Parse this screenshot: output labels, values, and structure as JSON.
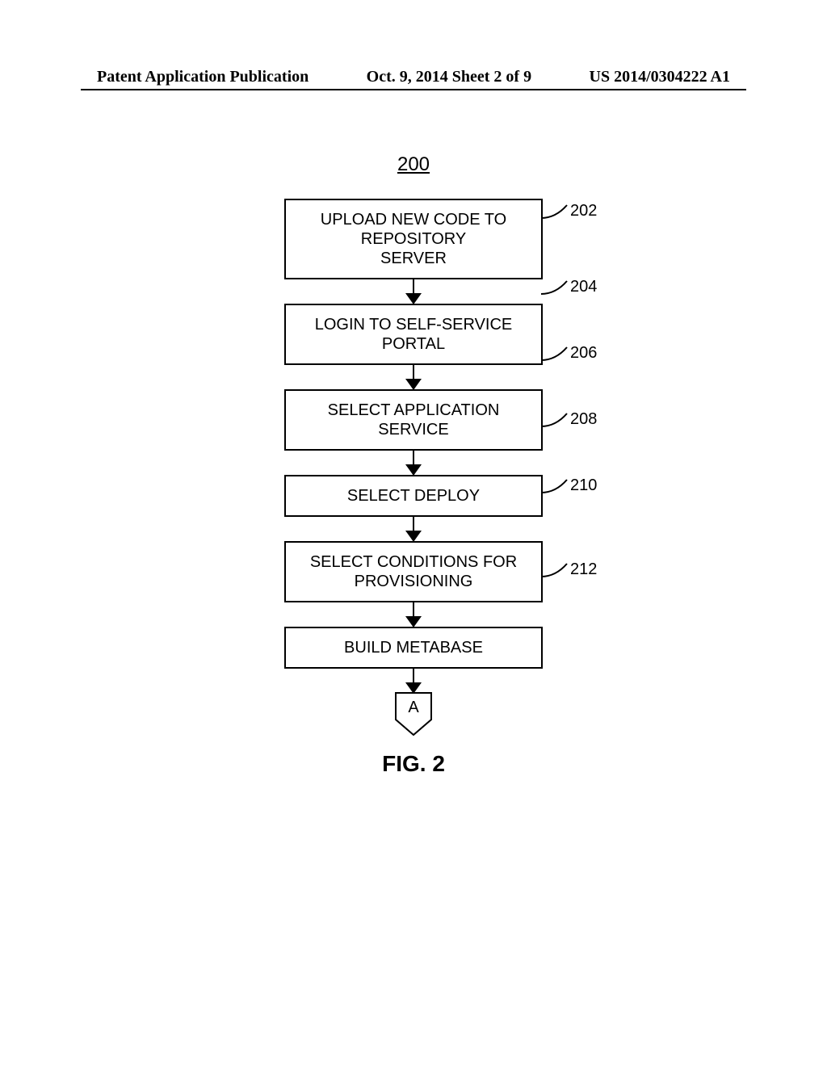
{
  "header": {
    "left": "Patent Application Publication",
    "center": "Oct. 9, 2014   Sheet 2 of 9",
    "right": "US 2014/0304222 A1"
  },
  "diagram": {
    "figure_number": "200",
    "connector_label": "A",
    "steps": [
      {
        "label_lines": [
          "UPLOAD NEW CODE TO REPOSITORY",
          "SERVER"
        ],
        "ref": "202"
      },
      {
        "label_lines": [
          "LOGIN TO SELF-SERVICE PORTAL"
        ],
        "ref": "204"
      },
      {
        "label_lines": [
          "SELECT APPLICATION SERVICE"
        ],
        "ref": "206"
      },
      {
        "label_lines": [
          "SELECT DEPLOY"
        ],
        "ref": "208"
      },
      {
        "label_lines": [
          "SELECT CONDITIONS FOR",
          "PROVISIONING"
        ],
        "ref": "210"
      },
      {
        "label_lines": [
          "BUILD METABASE"
        ],
        "ref": "212"
      }
    ]
  },
  "caption": "FIG. 2",
  "chart_data": {
    "type": "flowchart",
    "title": "FIG. 2",
    "figure_ref": "200",
    "nodes": [
      {
        "id": "202",
        "text": "UPLOAD NEW CODE TO REPOSITORY SERVER",
        "shape": "process"
      },
      {
        "id": "204",
        "text": "LOGIN TO SELF-SERVICE PORTAL",
        "shape": "process"
      },
      {
        "id": "206",
        "text": "SELECT APPLICATION SERVICE",
        "shape": "process"
      },
      {
        "id": "208",
        "text": "SELECT DEPLOY",
        "shape": "process"
      },
      {
        "id": "210",
        "text": "SELECT CONDITIONS FOR PROVISIONING",
        "shape": "process"
      },
      {
        "id": "212",
        "text": "BUILD METABASE",
        "shape": "process"
      },
      {
        "id": "A",
        "text": "A",
        "shape": "offpage-connector"
      }
    ],
    "edges": [
      {
        "from": "202",
        "to": "204"
      },
      {
        "from": "204",
        "to": "206"
      },
      {
        "from": "206",
        "to": "208"
      },
      {
        "from": "208",
        "to": "210"
      },
      {
        "from": "210",
        "to": "212"
      },
      {
        "from": "212",
        "to": "A"
      }
    ]
  }
}
